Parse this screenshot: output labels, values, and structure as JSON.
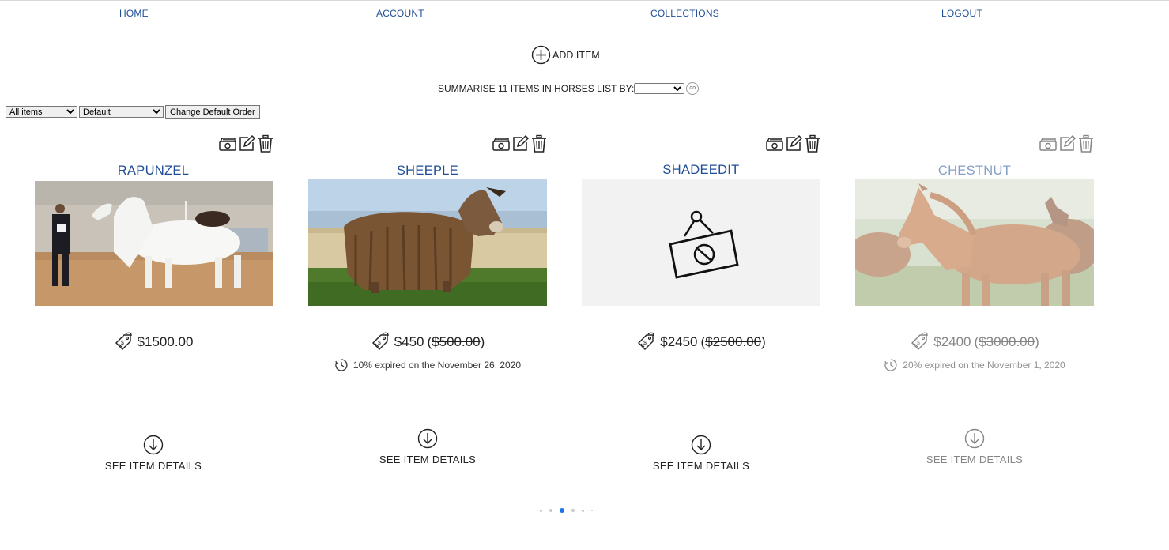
{
  "nav": {
    "home": "HOME",
    "account": "ACCOUNT",
    "collections": "COLLECTIONS",
    "logout": "LOGOUT"
  },
  "add_item": {
    "label": "ADD ITEM",
    "icon": "plus-circle-icon"
  },
  "summarise": {
    "label": "SUMMARISE 11 ITEMS IN HORSES LIST BY:",
    "select_value": "",
    "go_label": "GO"
  },
  "filters": {
    "filter_select": {
      "value": "All items",
      "options": [
        "All items"
      ]
    },
    "order_select": {
      "value": "Default",
      "options": [
        "Default"
      ]
    },
    "change_order_button": "Change Default Order"
  },
  "cards": [
    {
      "title": "RAPUNZEL",
      "price": "$1500.00",
      "original_price": "",
      "expiry": "",
      "details": "SEE ITEM DETAILS",
      "image": "white-horse-photo"
    },
    {
      "title": "SHEEPLE",
      "price": "$450",
      "original_price": "$500.00",
      "expiry": "10% expired on the November 26, 2020",
      "details": "SEE ITEM DETAILS",
      "image": "shaggy-donkey-photo"
    },
    {
      "title": "SHADEEDIT",
      "price": "$2450",
      "original_price": "$2500.00",
      "expiry": "",
      "details": "SEE ITEM DETAILS",
      "image": "no-image-placeholder"
    },
    {
      "title": "CHESTNUT",
      "price": "$2400",
      "original_price": "$3000.00",
      "expiry": "20% expired on the November 1, 2020",
      "details": "SEE ITEM DETAILS",
      "image": "chestnut-horse-photo",
      "faded": true
    }
  ],
  "card_action_icons": [
    "money-icon",
    "edit-icon",
    "trash-icon"
  ],
  "carousel": {
    "dot_count": 6,
    "active_index": 2
  },
  "colors": {
    "nav_text": "#1f4e96",
    "title_text": "#1f4e96",
    "active_dot": "#1a73e8"
  }
}
